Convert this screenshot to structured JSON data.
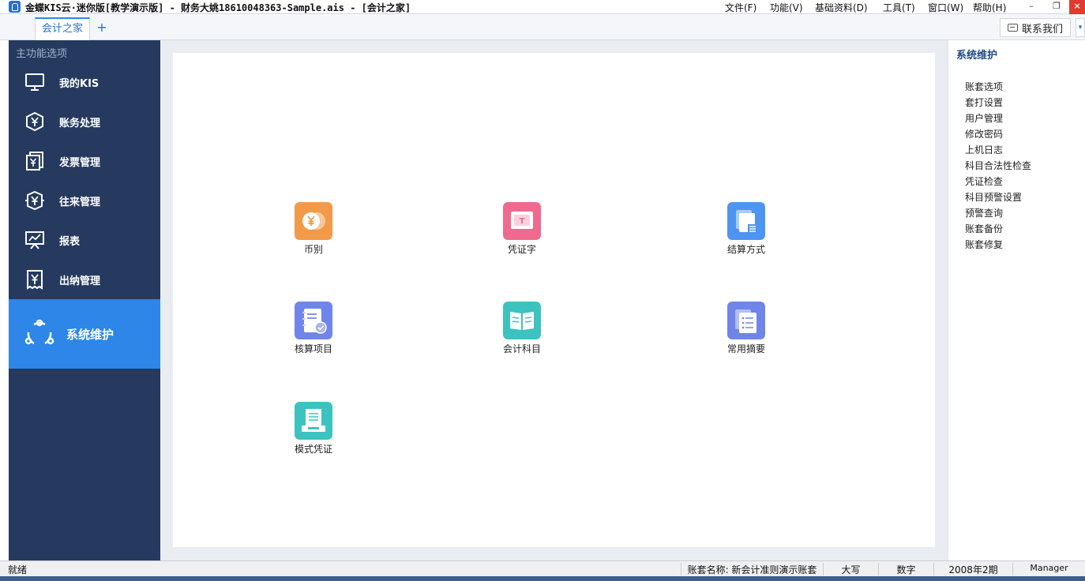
{
  "window": {
    "title": "金蝶KIS云·迷你版[教学演示版] - 财务大姚18610048363-Sample.ais - [会计之家]",
    "menus": [
      "文件(F)",
      "功能(V)",
      "基础资料(D)",
      "工具(T)",
      "窗口(W)",
      "帮助(H)"
    ],
    "controls": {
      "minimize": "–",
      "restore": "❐",
      "close": "×"
    }
  },
  "tabs": {
    "active_label": "会计之家",
    "add_symbol": "+",
    "contact_label": "联系我们",
    "collapse_symbol": "▾"
  },
  "sidebar": {
    "heading": "主功能选项",
    "items": [
      {
        "label": "我的KIS",
        "icon": "monitor-icon"
      },
      {
        "label": "账务处理",
        "icon": "yen-shield-icon"
      },
      {
        "label": "发票管理",
        "icon": "invoice-icon"
      },
      {
        "label": "往来管理",
        "icon": "exchange-icon"
      },
      {
        "label": "报表",
        "icon": "chart-board-icon"
      },
      {
        "label": "出纳管理",
        "icon": "cashier-receipt-icon"
      },
      {
        "label": "系统维护",
        "icon": "system-cycle-icon",
        "active": true
      }
    ]
  },
  "tiles": [
    {
      "label": "币别",
      "icon": "currency-icon",
      "color": "#f39a4a"
    },
    {
      "label": "凭证字",
      "icon": "voucher-word-icon",
      "color": "#f06a8f"
    },
    {
      "label": "结算方式",
      "icon": "settlement-icon",
      "color": "#4e95f2"
    },
    {
      "label": "核算项目",
      "icon": "accounting-item-icon",
      "color": "#6f85ea"
    },
    {
      "label": "会计科目",
      "icon": "account-book-icon",
      "color": "#3cc3c0"
    },
    {
      "label": "常用摘要",
      "icon": "summary-list-icon",
      "color": "#6f85ea"
    },
    {
      "label": "模式凭证",
      "icon": "template-voucher-icon",
      "color": "#3cc3c0"
    }
  ],
  "right_panel": {
    "title": "系统维护",
    "links": [
      "账套选项",
      "套打设置",
      "用户管理",
      "修改密码",
      "上机日志",
      "科目合法性检查",
      "凭证检查",
      "科目预警设置",
      "预警查询",
      "账套备份",
      "账套修复"
    ]
  },
  "status": {
    "ready": "就绪",
    "account_set": "账套名称: 新会计准则演示账套",
    "caps": "大写",
    "numlock": "数字",
    "period": "2008年2期",
    "user": "Manager"
  }
}
